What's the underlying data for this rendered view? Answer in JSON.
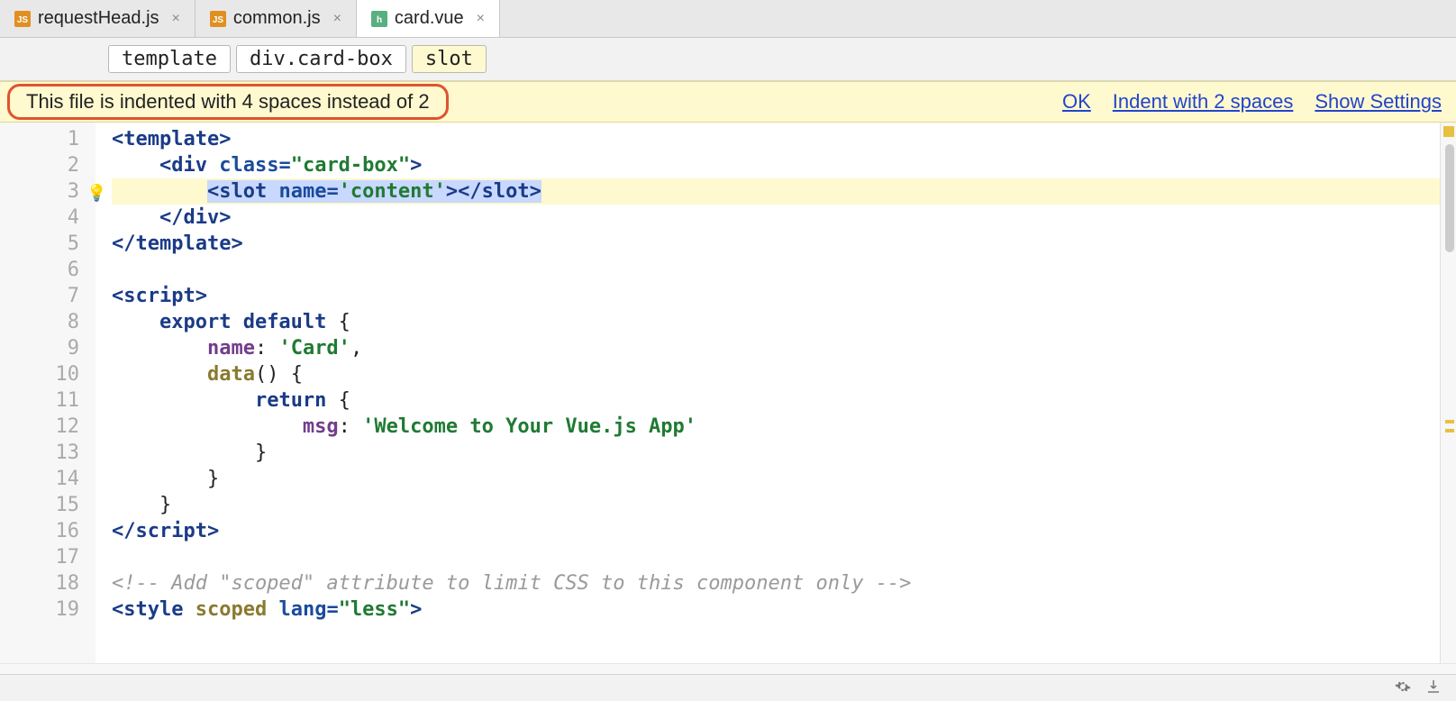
{
  "tabs": [
    {
      "label": "requestHead.js",
      "icon": "js",
      "active": false
    },
    {
      "label": "common.js",
      "icon": "js",
      "active": false
    },
    {
      "label": "card.vue",
      "icon": "vue",
      "active": true
    }
  ],
  "breadcrumb": {
    "items": [
      "template",
      "div.card-box",
      "slot"
    ],
    "highlighted_index": 2
  },
  "notification": {
    "message": "This file is indented with 4 spaces instead of 2",
    "actions": [
      "OK",
      "Indent with 2 spaces",
      "Show Settings"
    ]
  },
  "editor": {
    "line_count": 19,
    "current_line": 3,
    "intention_bulb_line": 3,
    "lines": {
      "l1": {
        "type": "tag-open",
        "indent": 0,
        "tag": "template"
      },
      "l2": {
        "type": "tag-open-attr",
        "indent": 1,
        "tag": "div",
        "attr": "class",
        "val": "card-box",
        "quote": "\""
      },
      "l3": {
        "type": "slot-line",
        "indent": 2,
        "tag": "slot",
        "attr": "name",
        "val": "content",
        "closetag": "slot"
      },
      "l4": {
        "type": "tag-close",
        "indent": 1,
        "tag": "div"
      },
      "l5": {
        "type": "tag-close",
        "indent": 0,
        "tag": "template"
      },
      "l6": {
        "type": "blank"
      },
      "l7": {
        "type": "tag-open",
        "indent": 0,
        "tag": "script"
      },
      "l8": {
        "type": "export",
        "indent": 1,
        "kw1": "export",
        "kw2": "default",
        "brace": "{"
      },
      "l9": {
        "type": "prop-str",
        "indent": 2,
        "prop": "name",
        "val": "Card",
        "trail": ","
      },
      "l10": {
        "type": "method",
        "indent": 2,
        "name": "data",
        "sig": "() {"
      },
      "l11": {
        "type": "return",
        "indent": 3,
        "kw": "return",
        "brace": "{"
      },
      "l12": {
        "type": "prop-str",
        "indent": 4,
        "prop": "msg",
        "val": "Welcome to Your Vue.js App",
        "trail": ""
      },
      "l13": {
        "type": "brace-close",
        "indent": 3
      },
      "l14": {
        "type": "brace-close",
        "indent": 2
      },
      "l15": {
        "type": "brace-close",
        "indent": 1
      },
      "l16": {
        "type": "tag-close",
        "indent": 0,
        "tag": "script"
      },
      "l17": {
        "type": "blank"
      },
      "l18": {
        "type": "comment",
        "indent": 0,
        "text": "<!-- Add \"scoped\" attribute to limit CSS to this component only -->"
      },
      "l19": {
        "type": "style-open",
        "indent": 0,
        "tag": "style",
        "attr1": "scoped",
        "attr2": "lang",
        "val2": "less"
      }
    }
  }
}
